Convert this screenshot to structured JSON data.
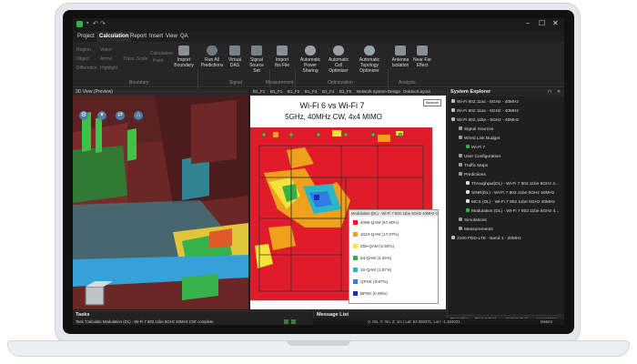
{
  "window": {
    "min": "–",
    "max": "☐",
    "close": "✕"
  },
  "menu": [
    "Project",
    "Calculation",
    "Report",
    "Insert",
    "View",
    "QA"
  ],
  "ribbon": {
    "small_items": [
      "Region",
      "Object",
      "Difference",
      "Video",
      "Arrow",
      "Highlight",
      "Trace",
      "Scale",
      "Calculation",
      "Point"
    ],
    "groups": [
      "Boundary",
      "Signal",
      "Measurement",
      "Optimization",
      "Analysis"
    ],
    "buttons": [
      {
        "label": "Import Boundary",
        "icon": "import-boundary-icon"
      },
      {
        "label": "Run All Predictions",
        "icon": "run-all-icon"
      },
      {
        "label": "Virtual DAS",
        "icon": "virtual-das-icon"
      },
      {
        "label": "Signal Source Set",
        "icon": "signal-source-icon"
      },
      {
        "label": "Import Ibs File",
        "icon": "import-file-icon"
      },
      {
        "label": "Automatic Power Sharing",
        "icon": "power-sharing-icon"
      },
      {
        "label": "Automatic Cell Optimizer",
        "icon": "cell-optimizer-icon"
      },
      {
        "label": "Automatic Topology Optimizer",
        "icon": "topology-icon"
      },
      {
        "label": "Antenna Isolation",
        "icon": "antenna-icon"
      },
      {
        "label": "Near-Far Effect",
        "icon": "near-far-icon"
      }
    ]
  },
  "view3d": {
    "tab": "3D View (Preview)"
  },
  "map_tabs": [
    "B1_F1",
    "B1_F1",
    "B1_F2",
    "B1_F3",
    "B1_F4",
    "B1_F5",
    "Network System Design",
    "OutdoorLayout"
  ],
  "map": {
    "title": "Wi-Fi 6 vs Wi-Fi 7",
    "subtitle": "5GHz, 40MHz CW, 4x4 MIMO",
    "logo": "Network"
  },
  "legend": {
    "title": "Modulation (DL) - Wi-Fi 7 802.11be 5GHz 40MHz CW",
    "rows": [
      {
        "label": "4096-QAM  (67.80%)",
        "color": "#e01c2a"
      },
      {
        "label": "1024-QAM  (17.07%)",
        "color": "#f0a11c"
      },
      {
        "label": "256-QAM  (2.92%)",
        "color": "#f5e23a"
      },
      {
        "label": "64-QAM  (3.34%)",
        "color": "#35b24a"
      },
      {
        "label": "16-QAM  (1.97%)",
        "color": "#29b6c9"
      },
      {
        "label": "QPSK  (0.97%)",
        "color": "#2f7ee0"
      },
      {
        "label": "BPSK  (0.05%)",
        "color": "#1d2fb5"
      }
    ]
  },
  "explorer": {
    "title": "System Explorer",
    "nodes": [
      {
        "label": "Wi-Fi 802.11ac - 5GHz - 40MHz",
        "indent": 0,
        "color": "#bbbbbb"
      },
      {
        "label": "Wi-Fi 802.11ax - 5GHz - 40MHz",
        "indent": 0,
        "color": "#bbbbbb"
      },
      {
        "label": "Wi-Fi 802.11be - 5GHz - 40MHz",
        "indent": 0,
        "color": "#bbbbbb"
      },
      {
        "label": "Signal Sources",
        "indent": 1,
        "color": "#999999"
      },
      {
        "label": "Wired Link Budget",
        "indent": 1,
        "color": "#999999"
      },
      {
        "label": "Wi-Fi 7",
        "indent": 2,
        "color": "#2fb34a"
      },
      {
        "label": "User Configuration",
        "indent": 1,
        "color": "#999999"
      },
      {
        "label": "Traffic Maps",
        "indent": 1,
        "color": "#999999"
      },
      {
        "label": "Predictions",
        "indent": 1,
        "color": "#999999"
      },
      {
        "label": "Throughput(DL) - Wi-Fi 7 802.11be 5GHz 4...",
        "indent": 2,
        "color": "#dddddd"
      },
      {
        "label": "SINR(DL) - Wi-Fi 7 802.11be 5GHz 40MHz",
        "indent": 2,
        "color": "#dddddd"
      },
      {
        "label": "MCS (DL) - Wi-Fi 7 802.11be 5GHz 40MHz",
        "indent": 2,
        "color": "#dddddd"
      },
      {
        "label": "Modulation (DL) - Wi-Fi 7 802.11be 5GHz 4...",
        "indent": 2,
        "color": "#2fb34a"
      },
      {
        "label": "Simulations",
        "indent": 1,
        "color": "#999999"
      },
      {
        "label": "Measurements",
        "indent": 1,
        "color": "#999999"
      },
      {
        "label": "2100 FDD-LTE - Band 1 - 20MHz",
        "indent": 0,
        "color": "#bbbbbb"
      }
    ],
    "tabs": [
      "Properties",
      "Project Expl...",
      "System Expl...",
      "Layer Mana..."
    ]
  },
  "tasks": {
    "title": "Tasks",
    "line": "Task 'Calculate Modulation (DL) - Wi-Fi 7 802.11be 5GHz 40MHz CW' complete"
  },
  "messages": {
    "title": "Message List"
  },
  "status": {
    "coords": "X: 0m, Y: 0m, Z: 1m | Lat: 52.050371, Lon: -1.184031",
    "units": "Meters"
  }
}
